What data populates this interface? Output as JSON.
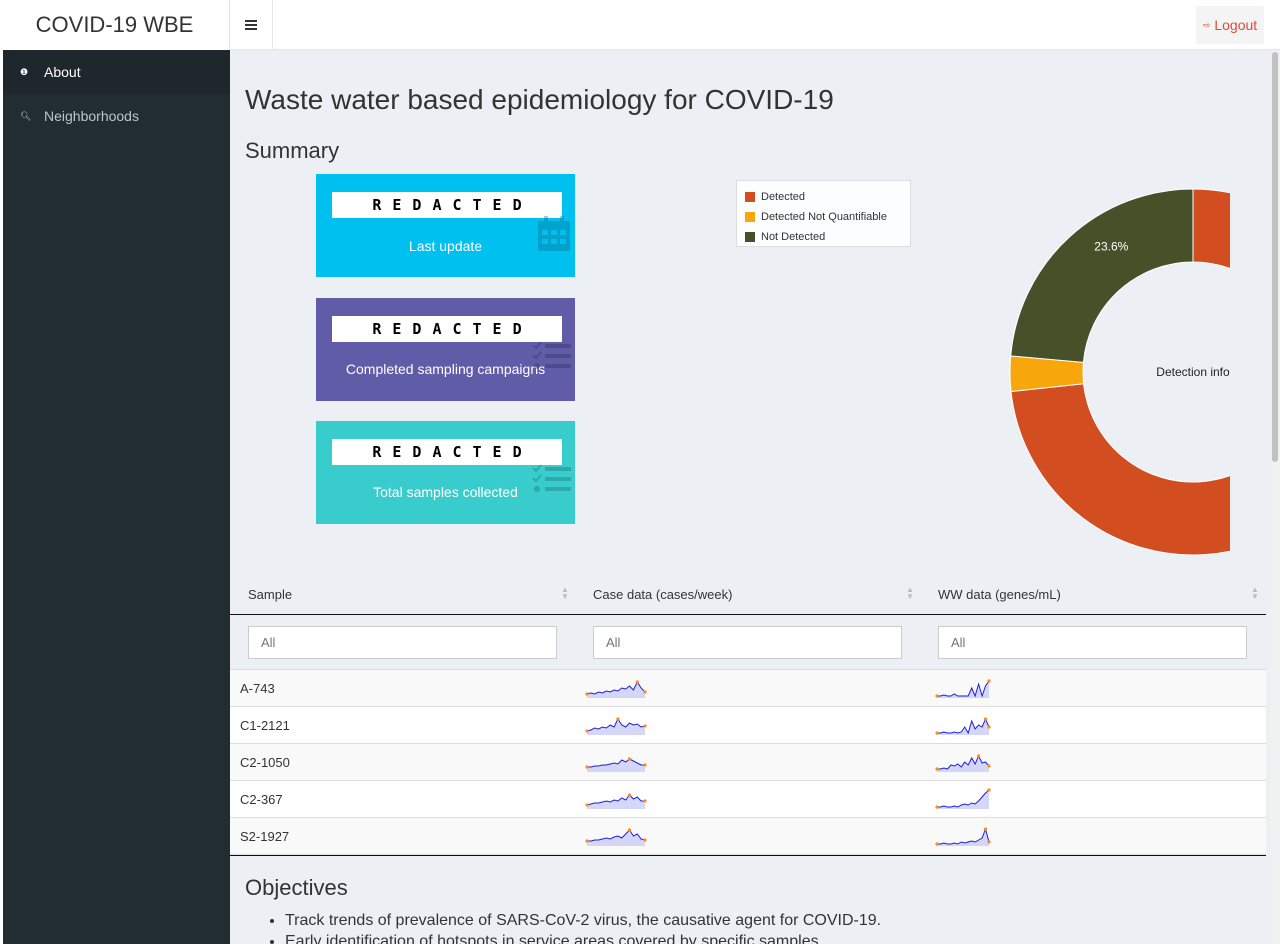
{
  "app": {
    "title": "COVID-19 WBE"
  },
  "header": {
    "logout_label": "Logout"
  },
  "sidebar": {
    "items": [
      {
        "label": "About",
        "icon": "info-icon",
        "active": true
      },
      {
        "label": "Neighborhoods",
        "icon": "search-icon",
        "active": false
      }
    ]
  },
  "main": {
    "title": "Waste water based epidemiology for COVID-19",
    "summary_title": "Summary",
    "boxes": [
      {
        "value": "REDACTED",
        "label": "Last update",
        "icon": "calendar-icon",
        "color": "#00c0ef"
      },
      {
        "value": "REDACTED",
        "label": "Completed sampling campaigns",
        "icon": "tasks-icon",
        "color": "#605ca8"
      },
      {
        "value": "REDACTED",
        "label": "Total samples collected",
        "icon": "tasks-icon",
        "color": "#39cccc"
      }
    ],
    "objectives_title": "Objectives",
    "objectives": [
      "Track trends of prevalence of SARS-CoV-2 virus, the causative agent for COVID-19.",
      "Early identification of hotspots in service areas covered by specific samples."
    ]
  },
  "chart_data": {
    "type": "pie",
    "center_label": "Detection info",
    "categories": [
      "Detected",
      "Detected Not Quantifiable",
      "Not Detected"
    ],
    "values": [
      73.3,
      3.1,
      23.6
    ],
    "labels": [
      "73.3%",
      "",
      "23.6%"
    ],
    "colors": [
      "#d24d1f",
      "#f7a70b",
      "#465129"
    ],
    "legend_position": "top-left"
  },
  "table": {
    "columns": [
      "Sample",
      "Case data (cases/week)",
      "WW data (genes/mL)"
    ],
    "filter_placeholder": "All",
    "rows": [
      {
        "sample": "A-743"
      },
      {
        "sample": "C1-2121"
      },
      {
        "sample": "C2-1050"
      },
      {
        "sample": "C2-367"
      },
      {
        "sample": "S2-1927"
      }
    ]
  }
}
